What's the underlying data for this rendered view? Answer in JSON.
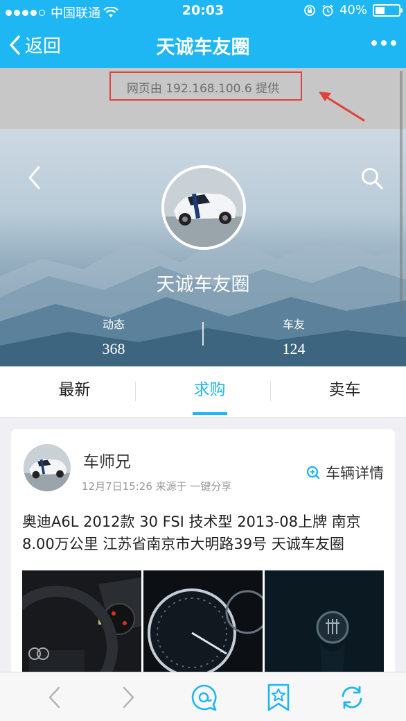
{
  "status_bar": {
    "carrier": "中国联通",
    "time": "20:03",
    "battery": "40%",
    "battery_level": 0.4
  },
  "nav": {
    "back_label": "返回",
    "title": "天诚车友圈"
  },
  "provider": {
    "text": "网页由 192.168.100.6 提供"
  },
  "hero": {
    "title": "天诚车友圈",
    "stats": [
      {
        "label": "动态",
        "value": "368"
      },
      {
        "label": "车友",
        "value": "124"
      }
    ]
  },
  "tabs": [
    {
      "label": "最新",
      "active": false
    },
    {
      "label": "求购",
      "active": true
    },
    {
      "label": "卖车",
      "active": false
    }
  ],
  "post": {
    "author": "车师兄",
    "meta": "12月7日15:26 来源于 一键分享",
    "detail_link": "车辆详情",
    "content": "奥迪A6L 2012款 30 FSI 技术型 2013-08上牌 南京 8.00万公里 江苏省南京市大明路39号 天诚车友圈"
  },
  "colors": {
    "accent": "#1fb6f4",
    "highlight_box": "#e0413a"
  },
  "toolbar": {
    "icons": [
      "chevron-left-icon",
      "chevron-right-icon",
      "chat-bubble-icon",
      "bookmark-star-icon",
      "refresh-icon"
    ]
  }
}
